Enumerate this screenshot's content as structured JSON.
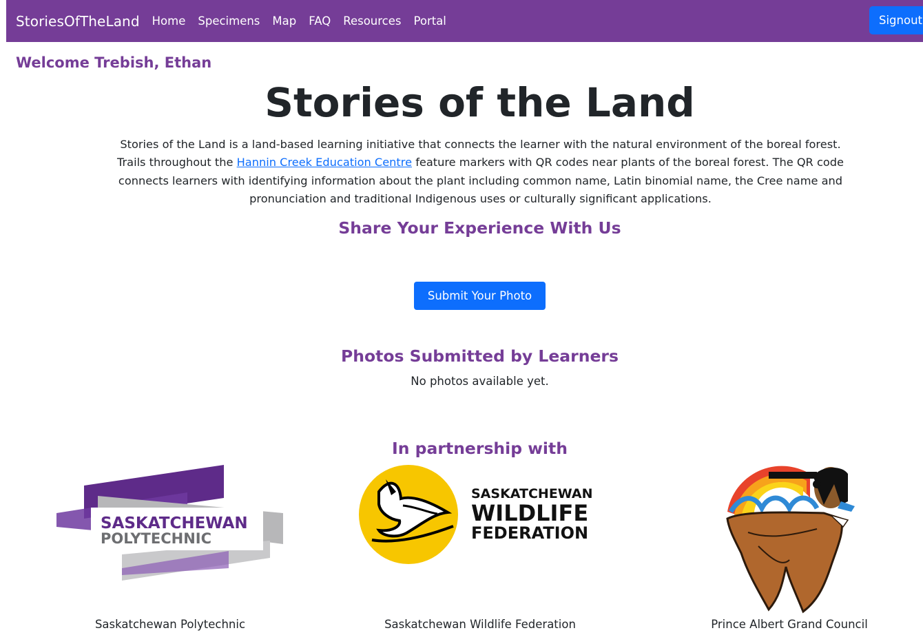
{
  "nav": {
    "brand": "StoriesOfTheLand",
    "links": [
      "Home",
      "Specimens",
      "Map",
      "FAQ",
      "Resources",
      "Portal"
    ],
    "signout": "Signout"
  },
  "welcome": "Welcome Trebish, Ethan",
  "title": "Stories of the Land",
  "intro": {
    "before_link": "Stories of the Land is a land-based learning initiative that connects the learner with the natural environment of the boreal forest. Trails throughout the ",
    "link_text": "Hannin Creek Education Centre",
    "after_link": " feature markers with QR codes near plants of the boreal forest. The QR code connects learners with identifying information about the plant including common name, Latin binomial name, the Cree name and pronunciation and traditional Indigenous uses or culturally significant applications."
  },
  "share_heading": "Share Your Experience With Us",
  "submit_button": "Submit Your Photo",
  "photos_heading": "Photos Submitted by Learners",
  "no_photos": "No photos available yet.",
  "partnership_heading": "In partnership with",
  "partners": [
    {
      "name": "Saskatchewan Polytechnic",
      "logo_text": [
        "SASKATCHEWAN",
        "POLYTECHNIC"
      ]
    },
    {
      "name": "Saskatchewan Wildlife Federation",
      "logo_text": [
        "SASKATCHEWAN",
        "WILDLIFE",
        "FEDERATION"
      ]
    },
    {
      "name": "Prince Albert Grand Council"
    }
  ],
  "colors": {
    "brand_purple": "#753d97",
    "primary_blue": "#0d6efd",
    "wildlife_yellow": "#f7c600"
  }
}
